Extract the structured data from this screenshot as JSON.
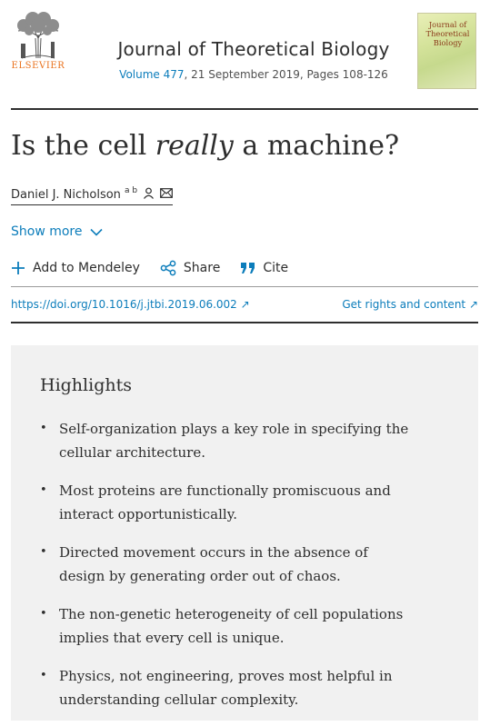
{
  "publisher": {
    "logo_text": "ELSEVIER"
  },
  "journal": {
    "title": "Journal of Theoretical Biology",
    "volume": "Volume 477",
    "meta_rest": ", 21 September 2019, Pages 108-126",
    "cover_text": "Journal of Theoretical Biology"
  },
  "article": {
    "title_before": "Is the cell ",
    "title_emph": "really",
    "title_after": " a machine?",
    "author_name": "Daniel J. Nicholson",
    "author_affil": "a b",
    "show_more": "Show more"
  },
  "actions": {
    "mendeley": "Add to Mendeley",
    "share": "Share",
    "cite": "Cite"
  },
  "links": {
    "doi": "https://doi.org/10.1016/j.jtbi.2019.06.002 ↗",
    "rights": "Get rights and content ↗"
  },
  "highlights": {
    "heading": "Highlights",
    "items": [
      "Self-organization plays a key role in specifying the cellular architecture.",
      "Most proteins are functionally promiscuous and interact opportunistically.",
      "Directed movement occurs in the absence of design by generating order out of chaos.",
      "The non-genetic heterogeneity of cell populations implies that every cell is unique.",
      "Physics, not engineering, proves most helpful in understanding cellular complexity."
    ]
  },
  "colors": {
    "link": "#0c7dbb",
    "publisher": "#e9711c",
    "panel": "#f1f1f1"
  },
  "icons": [
    "elsevier-tree-logo",
    "person-icon",
    "mail-icon",
    "chevron-down-icon",
    "plus-icon",
    "share-icon",
    "quote-icon"
  ]
}
